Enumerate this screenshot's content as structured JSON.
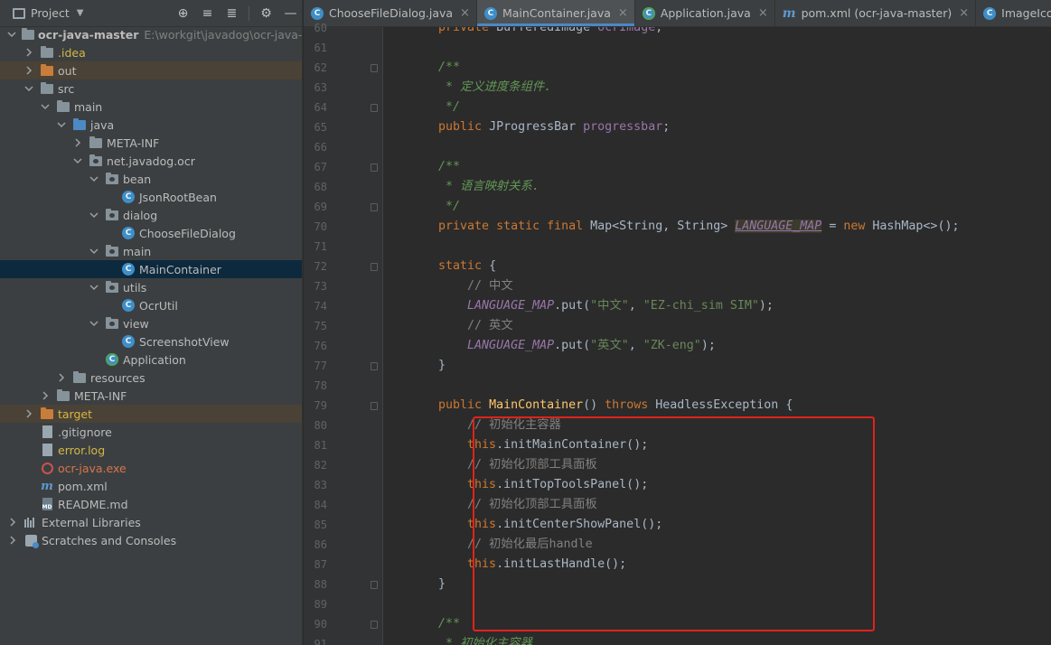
{
  "project_panel": {
    "title": "Project",
    "tree": [
      {
        "label": "ocr-java-master",
        "sub": "E:\\workgit\\javadog\\ocr-java-master",
        "depth": 0,
        "arrow": "down",
        "icon": "folder",
        "style": "bold"
      },
      {
        "label": ".idea",
        "depth": 1,
        "arrow": "right",
        "icon": "folder",
        "style": "yellow"
      },
      {
        "label": "out",
        "depth": 1,
        "arrow": "right",
        "icon": "folder-orange",
        "style": "",
        "excluded": true
      },
      {
        "label": "src",
        "depth": 1,
        "arrow": "down",
        "icon": "folder",
        "style": ""
      },
      {
        "label": "main",
        "depth": 2,
        "arrow": "down",
        "icon": "folder",
        "style": ""
      },
      {
        "label": "java",
        "depth": 3,
        "arrow": "down",
        "icon": "folder-blue",
        "style": ""
      },
      {
        "label": "META-INF",
        "depth": 4,
        "arrow": "right",
        "icon": "folder",
        "style": ""
      },
      {
        "label": "net.javadog.ocr",
        "depth": 4,
        "arrow": "down",
        "icon": "package",
        "style": ""
      },
      {
        "label": "bean",
        "depth": 5,
        "arrow": "down",
        "icon": "package",
        "style": ""
      },
      {
        "label": "JsonRootBean",
        "depth": 6,
        "arrow": "",
        "icon": "class",
        "style": ""
      },
      {
        "label": "dialog",
        "depth": 5,
        "arrow": "down",
        "icon": "package",
        "style": ""
      },
      {
        "label": "ChooseFileDialog",
        "depth": 6,
        "arrow": "",
        "icon": "class",
        "style": ""
      },
      {
        "label": "main",
        "depth": 5,
        "arrow": "down",
        "icon": "package",
        "style": ""
      },
      {
        "label": "MainContainer",
        "depth": 6,
        "arrow": "",
        "icon": "class",
        "style": "",
        "selected": true
      },
      {
        "label": "utils",
        "depth": 5,
        "arrow": "down",
        "icon": "package",
        "style": ""
      },
      {
        "label": "OcrUtil",
        "depth": 6,
        "arrow": "",
        "icon": "class",
        "style": ""
      },
      {
        "label": "view",
        "depth": 5,
        "arrow": "down",
        "icon": "package",
        "style": ""
      },
      {
        "label": "ScreenshotView",
        "depth": 6,
        "arrow": "",
        "icon": "class",
        "style": ""
      },
      {
        "label": "Application",
        "depth": 5,
        "arrow": "",
        "icon": "class-run",
        "style": ""
      },
      {
        "label": "resources",
        "depth": 3,
        "arrow": "right",
        "icon": "folder",
        "style": ""
      },
      {
        "label": "META-INF",
        "depth": 2,
        "arrow": "right",
        "icon": "folder",
        "style": ""
      },
      {
        "label": "target",
        "depth": 1,
        "arrow": "right",
        "icon": "folder-orange",
        "style": "yellow",
        "excluded": true
      },
      {
        "label": ".gitignore",
        "depth": 1,
        "arrow": "",
        "icon": "file",
        "style": ""
      },
      {
        "label": "error.log",
        "depth": 1,
        "arrow": "",
        "icon": "file",
        "style": "yellow"
      },
      {
        "label": "ocr-java.exe",
        "depth": 1,
        "arrow": "",
        "icon": "exe",
        "style": "orange-red"
      },
      {
        "label": "pom.xml",
        "depth": 1,
        "arrow": "",
        "icon": "maven",
        "style": ""
      },
      {
        "label": "README.md",
        "depth": 1,
        "arrow": "",
        "icon": "markdown",
        "style": ""
      },
      {
        "label": "External Libraries",
        "depth": 0,
        "arrow": "right",
        "icon": "libraries",
        "style": ""
      },
      {
        "label": "Scratches and Consoles",
        "depth": 0,
        "arrow": "right",
        "icon": "scratches",
        "style": ""
      }
    ]
  },
  "tabs": [
    {
      "label": "ChooseFileDialog.java",
      "icon": "class",
      "active": false
    },
    {
      "label": "MainContainer.java",
      "icon": "class",
      "active": true
    },
    {
      "label": "Application.java",
      "icon": "class-run",
      "active": false
    },
    {
      "label": "pom.xml (ocr-java-master)",
      "icon": "maven",
      "active": false
    },
    {
      "label": "ImageIcon.java",
      "icon": "class",
      "active": false
    }
  ],
  "code_lines": [
    {
      "n": "60",
      "fold": false,
      "tokens": [
        [
          "kw",
          "    private "
        ],
        [
          "",
          "BufferedImage "
        ],
        [
          "fld",
          "ocrImage"
        ],
        [
          "",
          ";"
        ]
      ]
    },
    {
      "n": "61",
      "fold": false,
      "tokens": []
    },
    {
      "n": "62",
      "fold": true,
      "tokens": [
        [
          "cm",
          "    /**"
        ]
      ]
    },
    {
      "n": "63",
      "fold": false,
      "tokens": [
        [
          "cm",
          "     * 定义进度条组件."
        ]
      ]
    },
    {
      "n": "64",
      "fold": true,
      "tokens": [
        [
          "cm",
          "     */"
        ]
      ]
    },
    {
      "n": "65",
      "fold": false,
      "tokens": [
        [
          "kw",
          "    public "
        ],
        [
          "",
          "JProgressBar "
        ],
        [
          "fld",
          "progressbar"
        ],
        [
          "",
          ";"
        ]
      ]
    },
    {
      "n": "66",
      "fold": false,
      "tokens": []
    },
    {
      "n": "67",
      "fold": true,
      "tokens": [
        [
          "cm",
          "    /**"
        ]
      ]
    },
    {
      "n": "68",
      "fold": false,
      "tokens": [
        [
          "cm",
          "     * 语言映射关系."
        ]
      ]
    },
    {
      "n": "69",
      "fold": true,
      "tokens": [
        [
          "cm",
          "     */"
        ]
      ]
    },
    {
      "n": "70",
      "fold": false,
      "tokens": [
        [
          "kw",
          "    private static final "
        ],
        [
          "",
          "Map<String, String> "
        ],
        [
          "sfld-hl",
          "LANGUAGE_MAP"
        ],
        [
          "",
          " = "
        ],
        [
          "kw",
          "new "
        ],
        [
          "",
          "HashMap<>();"
        ]
      ]
    },
    {
      "n": "71",
      "fold": false,
      "tokens": []
    },
    {
      "n": "72",
      "fold": true,
      "tokens": [
        [
          "kw",
          "    static "
        ],
        [
          "",
          "{"
        ]
      ]
    },
    {
      "n": "73",
      "fold": false,
      "tokens": [
        [
          "lc",
          "        // 中文"
        ]
      ]
    },
    {
      "n": "74",
      "fold": false,
      "tokens": [
        [
          "sfld",
          "        LANGUAGE_MAP"
        ],
        [
          "",
          ".put("
        ],
        [
          "str",
          "\"中文\""
        ],
        [
          "",
          ", "
        ],
        [
          "str",
          "\"EZ-chi_sim SIM\""
        ],
        [
          "",
          ");"
        ]
      ]
    },
    {
      "n": "75",
      "fold": false,
      "tokens": [
        [
          "lc",
          "        // 英文"
        ]
      ]
    },
    {
      "n": "76",
      "fold": false,
      "tokens": [
        [
          "sfld",
          "        LANGUAGE_MAP"
        ],
        [
          "",
          ".put("
        ],
        [
          "str",
          "\"英文\""
        ],
        [
          "",
          ", "
        ],
        [
          "str",
          "\"ZK-eng\""
        ],
        [
          "",
          ");"
        ]
      ]
    },
    {
      "n": "77",
      "fold": true,
      "tokens": [
        [
          "",
          "    }"
        ]
      ]
    },
    {
      "n": "78",
      "fold": false,
      "tokens": []
    },
    {
      "n": "79",
      "fold": true,
      "tokens": [
        [
          "kw",
          "    public "
        ],
        [
          "mth",
          "MainContainer"
        ],
        [
          "",
          "() "
        ],
        [
          "kw",
          "throws "
        ],
        [
          "",
          "HeadlessException {"
        ]
      ]
    },
    {
      "n": "80",
      "fold": false,
      "tokens": [
        [
          "lc",
          "        // 初始化主容器"
        ]
      ]
    },
    {
      "n": "81",
      "fold": false,
      "tokens": [
        [
          "kw",
          "        this"
        ],
        [
          "",
          "."
        ],
        [
          "",
          "initMainContainer();"
        ]
      ]
    },
    {
      "n": "82",
      "fold": false,
      "tokens": [
        [
          "lc",
          "        // 初始化顶部工具面板"
        ]
      ]
    },
    {
      "n": "83",
      "fold": false,
      "tokens": [
        [
          "kw",
          "        this"
        ],
        [
          "",
          "."
        ],
        [
          "",
          "initTopToolsPanel();"
        ]
      ]
    },
    {
      "n": "84",
      "fold": false,
      "tokens": [
        [
          "lc",
          "        // 初始化顶部工具面板"
        ]
      ]
    },
    {
      "n": "85",
      "fold": false,
      "tokens": [
        [
          "kw",
          "        this"
        ],
        [
          "",
          "."
        ],
        [
          "",
          "initCenterShowPanel();"
        ]
      ]
    },
    {
      "n": "86",
      "fold": false,
      "tokens": [
        [
          "lc",
          "        // 初始化最后handle"
        ]
      ]
    },
    {
      "n": "87",
      "fold": false,
      "tokens": [
        [
          "kw",
          "        this"
        ],
        [
          "",
          "."
        ],
        [
          "",
          "initLastHandle();"
        ]
      ]
    },
    {
      "n": "88",
      "fold": true,
      "tokens": [
        [
          "",
          "    }"
        ]
      ]
    },
    {
      "n": "89",
      "fold": false,
      "tokens": []
    },
    {
      "n": "90",
      "fold": true,
      "tokens": [
        [
          "cm",
          "    /**"
        ]
      ]
    },
    {
      "n": "91",
      "fold": false,
      "tokens": [
        [
          "cm",
          "     * 初始化主容器"
        ]
      ]
    }
  ],
  "colors": {
    "highlight_box": "#e0231b",
    "selection": "#0d293e",
    "active_tab_underline": "#4a88c7"
  }
}
